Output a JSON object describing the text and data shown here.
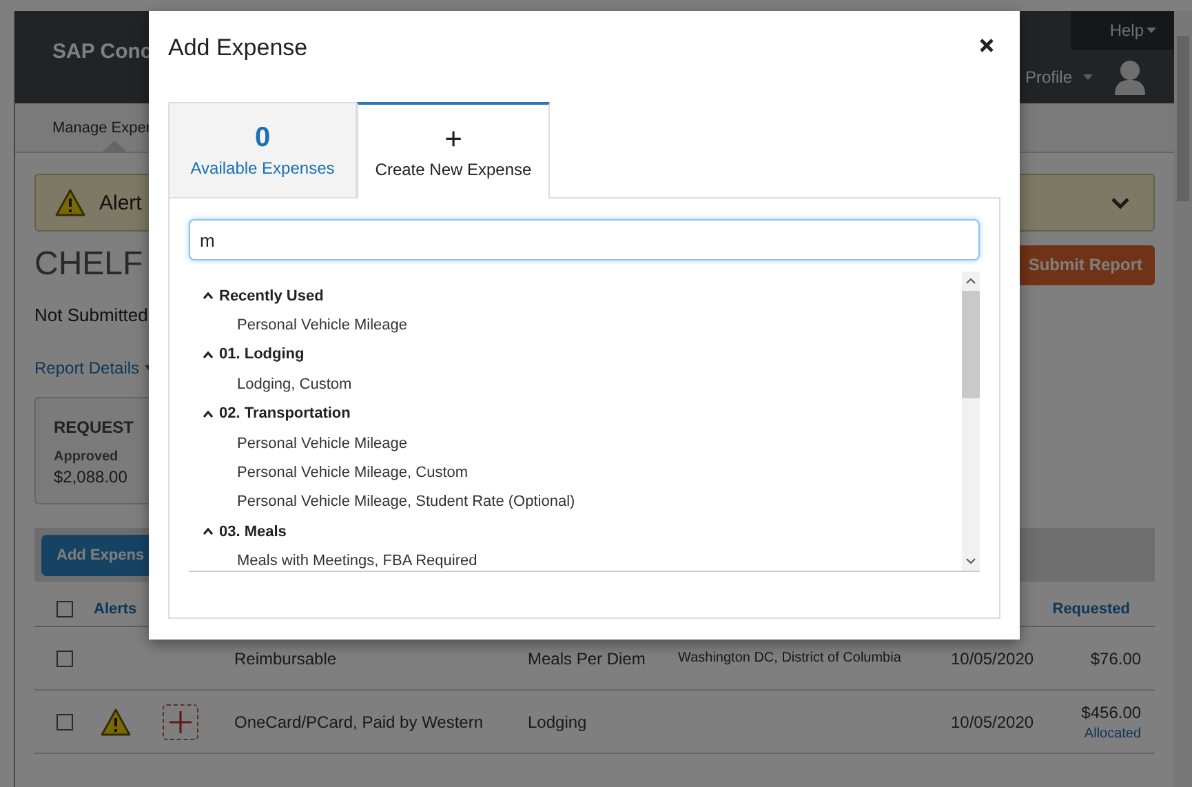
{
  "header": {
    "brand": "SAP Conc",
    "help": "Help",
    "profile": "Profile"
  },
  "subnav": {
    "tab": "Manage Exper"
  },
  "alerts": {
    "label": "Alert"
  },
  "report": {
    "title": "CHELF",
    "status": "Not Submitted",
    "details_link": "Report Details",
    "submit_button": "Submit Report"
  },
  "request_card": {
    "heading": "REQUEST",
    "label": "Approved",
    "amount": "$2,088.00"
  },
  "toolbar": {
    "add_button": "Add Expens"
  },
  "table": {
    "columns": [
      {
        "label": "Alerts",
        "checked": false
      },
      {
        "label": "Requested"
      }
    ],
    "rows": [
      {
        "checked": false,
        "alert": false,
        "receipt": false,
        "type": "Reimbursable",
        "expense_type": "Meals Per Diem",
        "location": "Washington DC, District of Columbia",
        "date": "10/05/2020",
        "amount": "$76.00"
      },
      {
        "checked": false,
        "alert": true,
        "receipt": true,
        "type": "OneCard/PCard, Paid by Western",
        "expense_type": "Lodging",
        "date": "10/05/2020",
        "amount": "$456.00",
        "note": "Allocated"
      }
    ]
  },
  "modal": {
    "title": "Add Expense",
    "tabs": [
      {
        "symbol": "0",
        "label": "Available Expenses",
        "selected": false
      },
      {
        "symbol": "+",
        "label": "Create New Expense",
        "selected": true
      }
    ],
    "search": {
      "value": "m"
    },
    "groups": [
      {
        "label": "Recently Used",
        "expanded": true,
        "children": [
          {
            "label": "Personal Vehicle Mileage"
          }
        ]
      },
      {
        "label": "01. Lodging",
        "expanded": true,
        "children": [
          {
            "label": "Lodging, Custom"
          }
        ]
      },
      {
        "label": "02. Transportation",
        "expanded": true,
        "children": [
          {
            "label": "Personal Vehicle Mileage"
          },
          {
            "label": "Personal Vehicle Mileage, Custom"
          },
          {
            "label": "Personal Vehicle Mileage, Student Rate (Optional)"
          }
        ]
      },
      {
        "label": "03. Meals",
        "expanded": true,
        "children": [
          {
            "label": "Meals with Meetings, FBA Required"
          }
        ]
      }
    ]
  }
}
